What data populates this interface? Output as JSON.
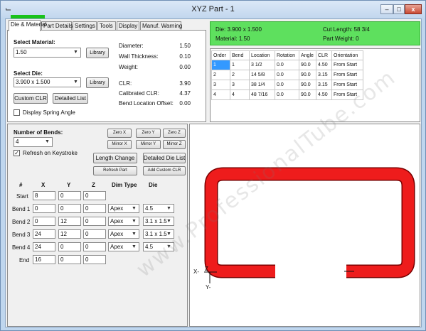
{
  "window": {
    "title": "XYZ Part - 1",
    "app_icon": "bend-app-icon",
    "controls": [
      "–",
      "□",
      "x"
    ]
  },
  "tabs": [
    "Die & Material",
    "Part Details",
    "Settings",
    "Tools",
    "Display",
    "Manuf. Warning"
  ],
  "material": {
    "label": "Select Material:",
    "value": "1.50",
    "library_button": "Library",
    "props": [
      {
        "label": "Diameter:",
        "value": "1.50"
      },
      {
        "label": "Wall Thickness:",
        "value": "0.10"
      },
      {
        "label": "Weight:",
        "value": "0.00"
      }
    ]
  },
  "die": {
    "label": "Select Die:",
    "value": "3.900 x 1.500",
    "library_button": "Library",
    "props": [
      {
        "label": "CLR:",
        "value": "3.90"
      },
      {
        "label": "Calibrated CLR:",
        "value": "4.37"
      },
      {
        "label": "Bend Location Offset:",
        "value": "0.00"
      }
    ],
    "custom_clr_button": "Custom CLR",
    "detailed_list_button": "Detailed List",
    "spring_angle_label": "Display Spring Angle",
    "spring_angle_checked": false
  },
  "summary": {
    "die": "Die: 3.900 x 1.500",
    "material": "Material: 1.50",
    "cut_length": "Cut Length: 58 3/4",
    "part_weight": "Part Weight: 0",
    "color": "#5ee05e"
  },
  "bend_table": {
    "headers": [
      "Order",
      "Bend",
      "Location",
      "Rotation",
      "Angle",
      "CLR",
      "Orientation"
    ],
    "rows": [
      [
        "1",
        "1",
        "3 1/2",
        "0.0",
        "90.0",
        "4.50",
        "From Start"
      ],
      [
        "2",
        "2",
        "14 5/8",
        "0.0",
        "90.0",
        "3.15",
        "From Start"
      ],
      [
        "3",
        "3",
        "38 1/4",
        "0.0",
        "90.0",
        "3.15",
        "From Start"
      ],
      [
        "4",
        "4",
        "48 7/16",
        "0.0",
        "90.0",
        "4.50",
        "From Start"
      ]
    ]
  },
  "bends": {
    "label": "Number of Bends:",
    "count": "4",
    "refresh_label": "Refresh on Keystroke",
    "refresh_checked": true,
    "buttons": {
      "zero_x": "Zero X",
      "zero_y": "Zero Y",
      "zero_z": "Zero Z",
      "mirror_x": "Mirror X",
      "mirror_y": "Mirror Y",
      "mirror_z": "Mirror Z",
      "length_change": "Length Change",
      "detailed_die_list": "Detailed Die List",
      "refresh_part": "Refresh Part",
      "add_custom_clr": "Add Custom CLR"
    },
    "headers": [
      "#",
      "X",
      "Y",
      "Z",
      "Dim Type",
      "Die"
    ],
    "rows": [
      {
        "name": "Start",
        "x": "8",
        "y": "0",
        "z": "0",
        "dim": "",
        "die": ""
      },
      {
        "name": "Bend 1",
        "x": "0",
        "y": "0",
        "z": "0",
        "dim": "Apex",
        "die": "4.5"
      },
      {
        "name": "Bend 2",
        "x": "0",
        "y": "12",
        "z": "0",
        "dim": "Apex",
        "die": "3.1 x 1.5"
      },
      {
        "name": "Bend 3",
        "x": "24",
        "y": "12",
        "z": "0",
        "dim": "Apex",
        "die": "3.1 x 1.5"
      },
      {
        "name": "Bend 4",
        "x": "24",
        "y": "0",
        "z": "0",
        "dim": "Apex",
        "die": "4.5"
      },
      {
        "name": "End",
        "x": "16",
        "y": "0",
        "z": "0",
        "dim": "",
        "die": ""
      }
    ]
  },
  "viewport": {
    "axis_x_label": "X-",
    "axis_z_label": "Z",
    "axis_y_label": "Y-",
    "tube_color": "#ee1c1c"
  },
  "watermark": "www.ProfessionalTube.com"
}
